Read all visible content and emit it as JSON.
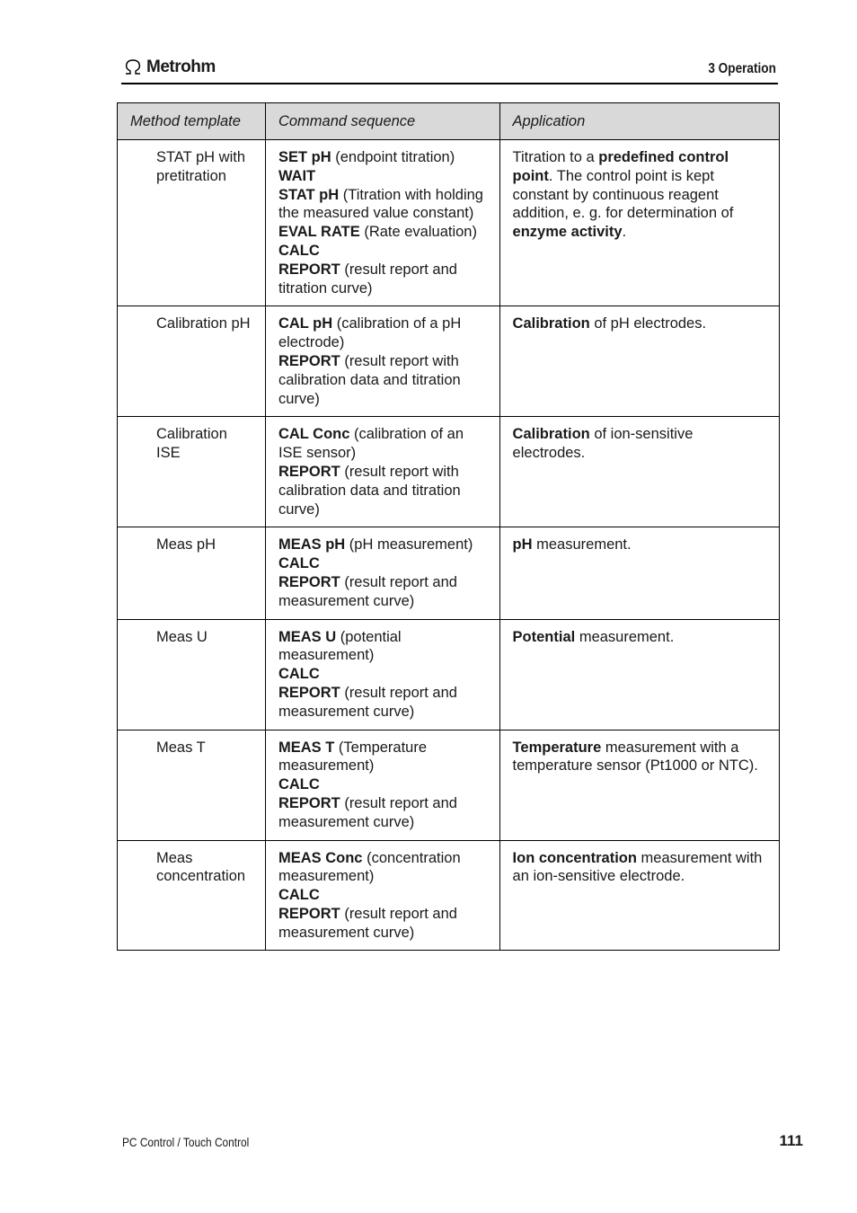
{
  "header": {
    "brand": "Metrohm",
    "chapter": "3 Operation"
  },
  "table": {
    "columns": [
      "Method template",
      "Command sequence",
      "Application"
    ],
    "rows": [
      {
        "template": "STAT pH with pretitration",
        "commands": [
          {
            "cmd": "SET pH",
            "desc": " (endpoint titration)"
          },
          {
            "cmd": "WAIT",
            "desc": ""
          },
          {
            "cmd": "STAT pH",
            "desc": " (Titration with holding the measured value constant)"
          },
          {
            "cmd": "EVAL RATE",
            "desc": " (Rate evaluation)"
          },
          {
            "cmd": "CALC",
            "desc": ""
          },
          {
            "cmd": "REPORT",
            "desc": " (result report and titration curve)"
          }
        ],
        "application": [
          {
            "t": "Titration to a ",
            "b": false
          },
          {
            "t": "predefined control point",
            "b": true
          },
          {
            "t": ". The control point is kept constant by continuous reagent addition, e. g. for determination of ",
            "b": false
          },
          {
            "t": "enzyme activity",
            "b": true
          },
          {
            "t": ".",
            "b": false
          }
        ]
      },
      {
        "template": "Calibration pH",
        "commands": [
          {
            "cmd": "CAL pH",
            "desc": " (calibration of a pH electrode)"
          },
          {
            "cmd": "REPORT",
            "desc": " (result report with calibration data and titration curve)"
          }
        ],
        "application": [
          {
            "t": "Calibration",
            "b": true
          },
          {
            "t": " of pH electrodes.",
            "b": false
          }
        ]
      },
      {
        "template": "Calibration ISE",
        "commands": [
          {
            "cmd": "CAL Conc",
            "desc": " (calibration of an ISE sensor)"
          },
          {
            "cmd": "REPORT",
            "desc": " (result report with calibration data and titration curve)"
          }
        ],
        "application": [
          {
            "t": "Calibration",
            "b": true
          },
          {
            "t": " of ion-sensitive electrodes.",
            "b": false
          }
        ]
      },
      {
        "template": "Meas pH",
        "commands": [
          {
            "cmd": "MEAS pH",
            "desc": " (pH measurement)"
          },
          {
            "cmd": "CALC",
            "desc": ""
          },
          {
            "cmd": "REPORT",
            "desc": " (result report and measurement curve)"
          }
        ],
        "application": [
          {
            "t": "pH",
            "b": true
          },
          {
            "t": " measurement.",
            "b": false
          }
        ]
      },
      {
        "template": "Meas U",
        "commands": [
          {
            "cmd": "MEAS U",
            "desc": " (potential measurement)"
          },
          {
            "cmd": "CALC",
            "desc": ""
          },
          {
            "cmd": "REPORT",
            "desc": " (result report and measurement curve)"
          }
        ],
        "application": [
          {
            "t": "Potential",
            "b": true
          },
          {
            "t": " measurement.",
            "b": false
          }
        ]
      },
      {
        "template": "Meas T",
        "commands": [
          {
            "cmd": "MEAS T",
            "desc": " (Temperature measurement)"
          },
          {
            "cmd": "CALC",
            "desc": ""
          },
          {
            "cmd": "REPORT",
            "desc": " (result report and measurement curve)"
          }
        ],
        "application": [
          {
            "t": "Temperature",
            "b": true
          },
          {
            "t": " measurement with a temperature sensor (Pt1000 or NTC).",
            "b": false
          }
        ]
      },
      {
        "template": "Meas concentration",
        "commands": [
          {
            "cmd": "MEAS Conc",
            "desc": " (concentration measurement)"
          },
          {
            "cmd": "CALC",
            "desc": ""
          },
          {
            "cmd": "REPORT",
            "desc": " (result report and measurement curve)"
          }
        ],
        "application": [
          {
            "t": "Ion concentration",
            "b": true
          },
          {
            "t": " measurement with an ion-sensitive electrode.",
            "b": false
          }
        ]
      }
    ]
  },
  "footer": {
    "product": "PC Control / Touch Control",
    "page_number": "111"
  }
}
